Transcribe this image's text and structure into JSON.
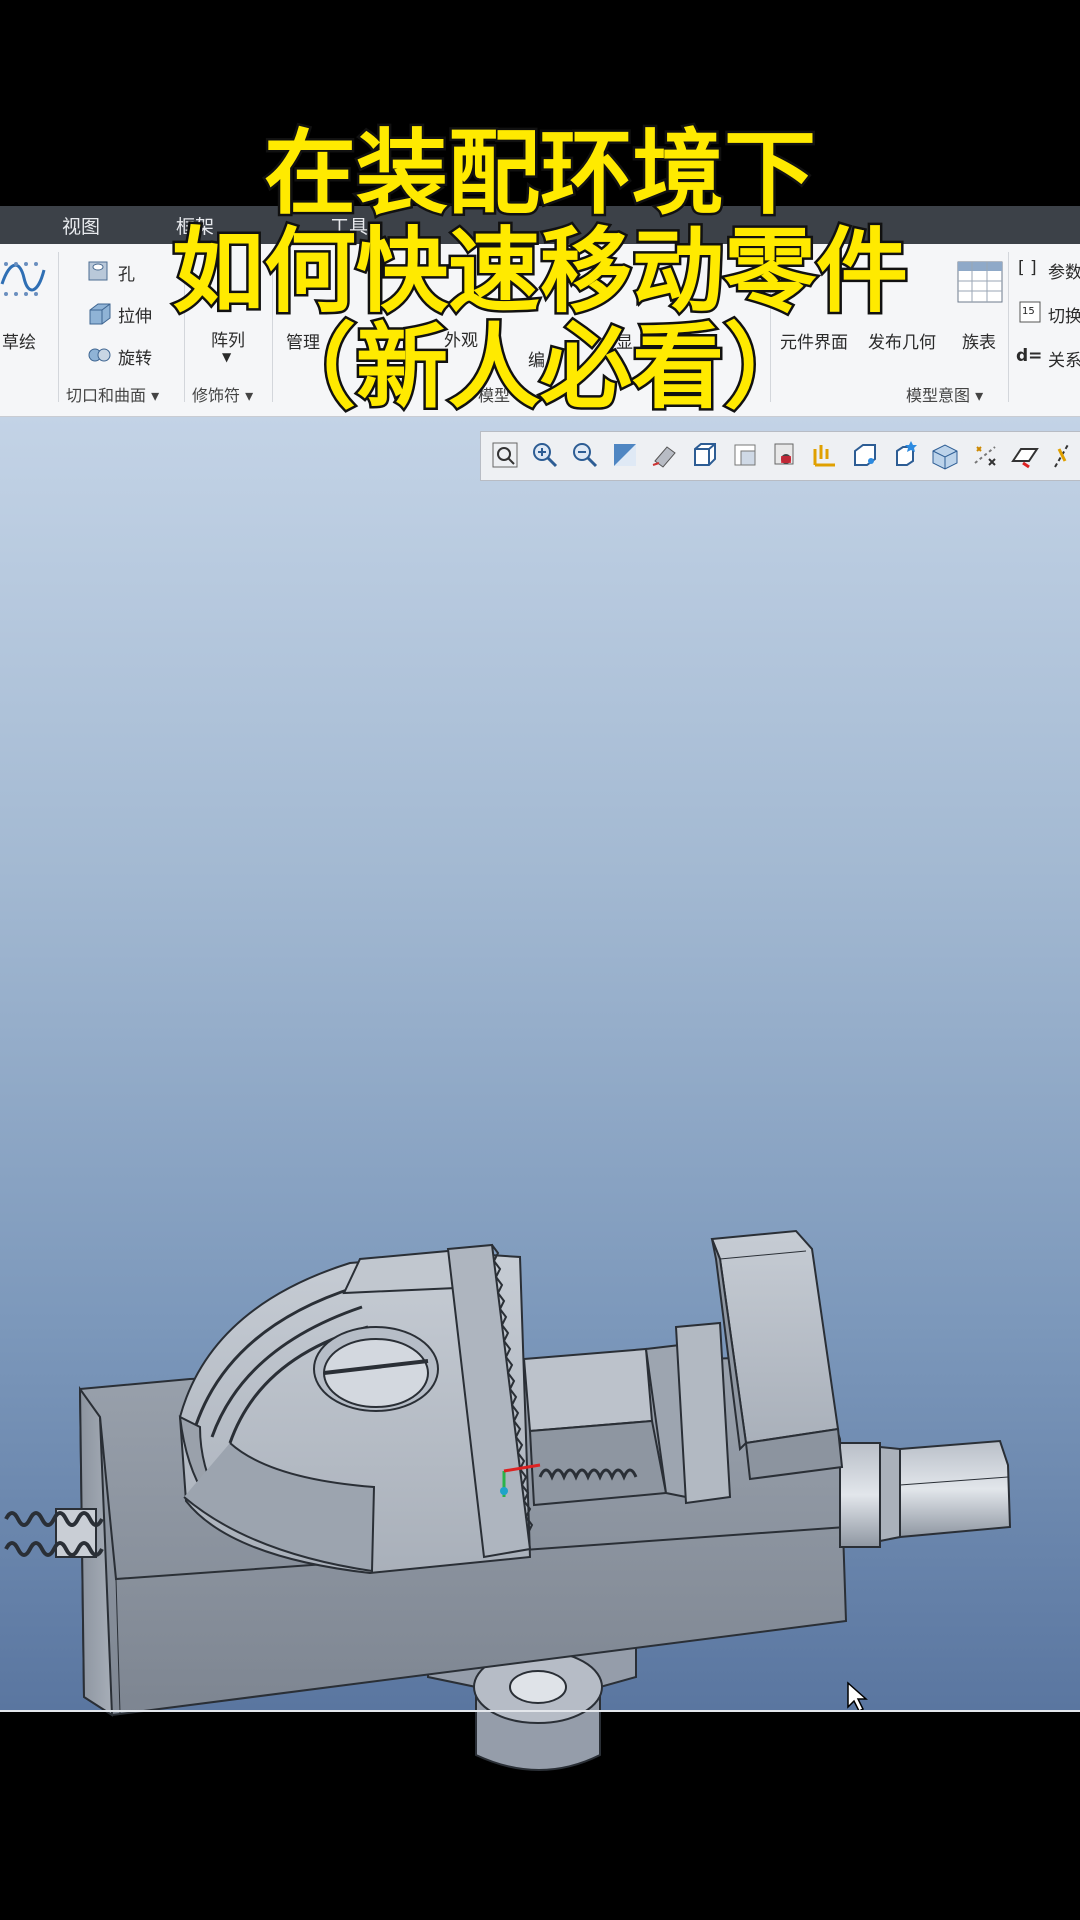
{
  "caption": {
    "line1": "在装配环境下",
    "line2": "如何快速移动零件",
    "line3": "（新人必看）"
  },
  "menubar": {
    "items": [
      "视图",
      "框架",
      "工具"
    ]
  },
  "ribbon": {
    "sketch_label": "草绘",
    "hole_label": "孔",
    "extrude_label": "拉伸",
    "revolve_label": "旋转",
    "pattern_label": "阵列",
    "manage_label": "管理",
    "appearance_label": "外观",
    "edit_label": "编",
    "display_label": "显",
    "component_interface_label": "元件界面",
    "publish_geometry_label": "发布几何",
    "family_table_label": "族表",
    "parameters_label": "参数",
    "switch_label": "切换",
    "relations_label": "关系",
    "group_cut_surface": "切口和曲面",
    "group_decorations": "修饰符",
    "group_model": "模型",
    "group_model_intent": "模型意图"
  },
  "view_toolbar": {
    "buttons": [
      "refit-icon",
      "zoom-in-icon",
      "zoom-out-icon",
      "repaint-icon",
      "orient-icon",
      "saved-views-icon",
      "display-style-icon",
      "perspective-icon",
      "datum-display-icon",
      "spin-center-icon",
      "annotation-icon",
      "section-icon",
      "point-icon",
      "plane-icon",
      "axis-icon"
    ]
  },
  "colors": {
    "caption_fill": "#ffea00",
    "menubar_bg": "#3c4148",
    "ribbon_bg": "#f5f6f8"
  }
}
